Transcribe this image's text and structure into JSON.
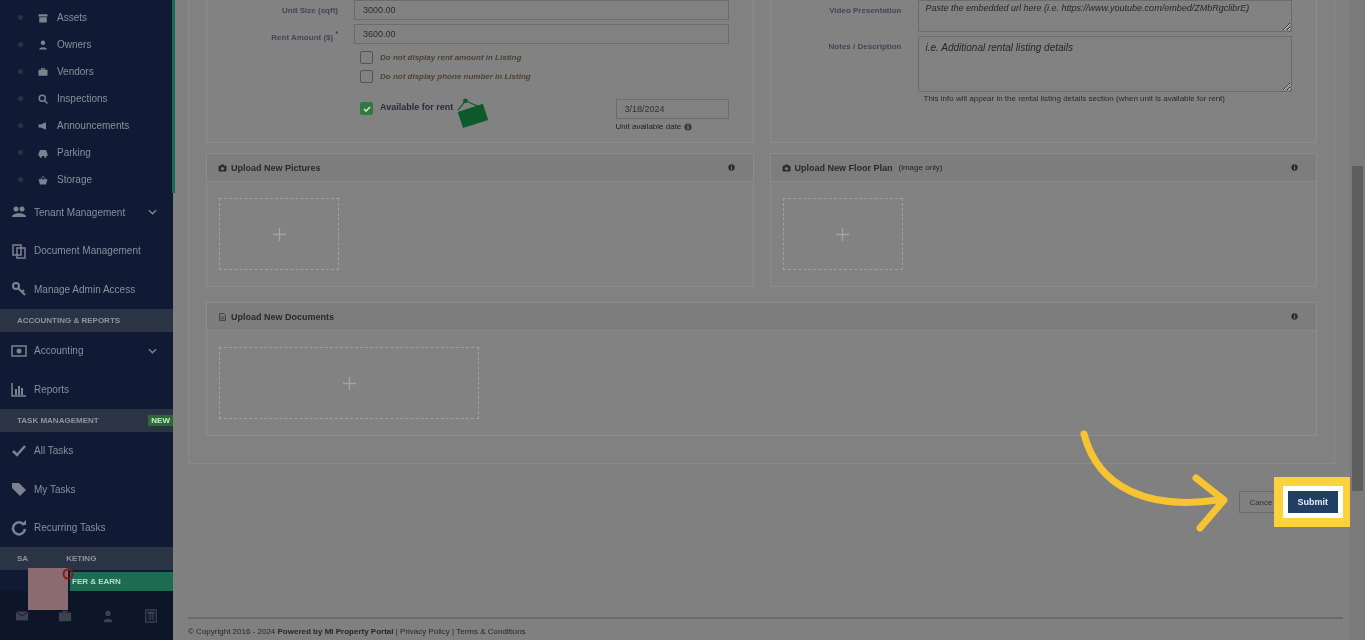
{
  "sidebar": {
    "sub_items": [
      {
        "label": "Assets"
      },
      {
        "label": "Owners"
      },
      {
        "label": "Vendors"
      },
      {
        "label": "Inspections"
      },
      {
        "label": "Announcements"
      },
      {
        "label": "Parking"
      },
      {
        "label": "Storage"
      }
    ],
    "groups": [
      {
        "items": [
          {
            "label": "Tenant Management",
            "kind": "menu"
          },
          {
            "label": "Document Management",
            "kind": "link"
          },
          {
            "label": "Manage Admin Access",
            "kind": "link"
          }
        ]
      },
      {
        "header": "ACCOUNTING & REPORTS",
        "items": [
          {
            "label": "Accounting",
            "kind": "menu"
          },
          {
            "label": "Reports",
            "kind": "link"
          }
        ]
      },
      {
        "header": "TASK MANAGEMENT",
        "badge": "NEW",
        "items": [
          {
            "label": "All Tasks",
            "kind": "link"
          },
          {
            "label": "My Tasks",
            "kind": "link"
          },
          {
            "label": "Recurring Tasks",
            "kind": "link"
          }
        ]
      }
    ],
    "last_header_start": "SA",
    "last_header_end": "KETING",
    "refer_button": "FER & EARN"
  },
  "listing_form": {
    "fields": [
      {
        "label": "Unit Size (sqft)",
        "value": "3000.00"
      },
      {
        "label": "Rent Amount ($) $^{*}$",
        "value": "3600.00"
      }
    ],
    "options": [
      {
        "label": "Do not display rent amount in Listing",
        "checked": false
      },
      {
        "label": "Do not display phone number in Listing",
        "checked": false
      }
    ],
    "available": {
      "label": "Available for rent",
      "checked": true,
      "date": "3/18/2024",
      "date_hint": "Unit available date"
    }
  },
  "details_form": {
    "video": {
      "label": "Video Presentation",
      "placeholder": "Paste the embedded url here (i.e. https://www.youtube.com/embed/ZMbRgclibrE)"
    },
    "notes": {
      "label": "Notes / Description",
      "placeholder": "i.e. Additional rental listing details"
    },
    "help": "This info will appear in the rental listing details section (when unit is available for rent)"
  },
  "uploads": [
    {
      "title": "Upload New Pictures",
      "kind": "image"
    },
    {
      "title": "Upload New Floor Plan",
      "note": "(image only)",
      "kind": "image"
    },
    {
      "title": "Upload New Documents",
      "kind": "document"
    }
  ],
  "actions": {
    "cancel": "Cance",
    "submit": "Submit"
  },
  "footer": {
    "text": "© Copyright 2016 - 2024 **Powered by MI Property Portal** | Privacy Policy | Terms & Conditions"
  }
}
